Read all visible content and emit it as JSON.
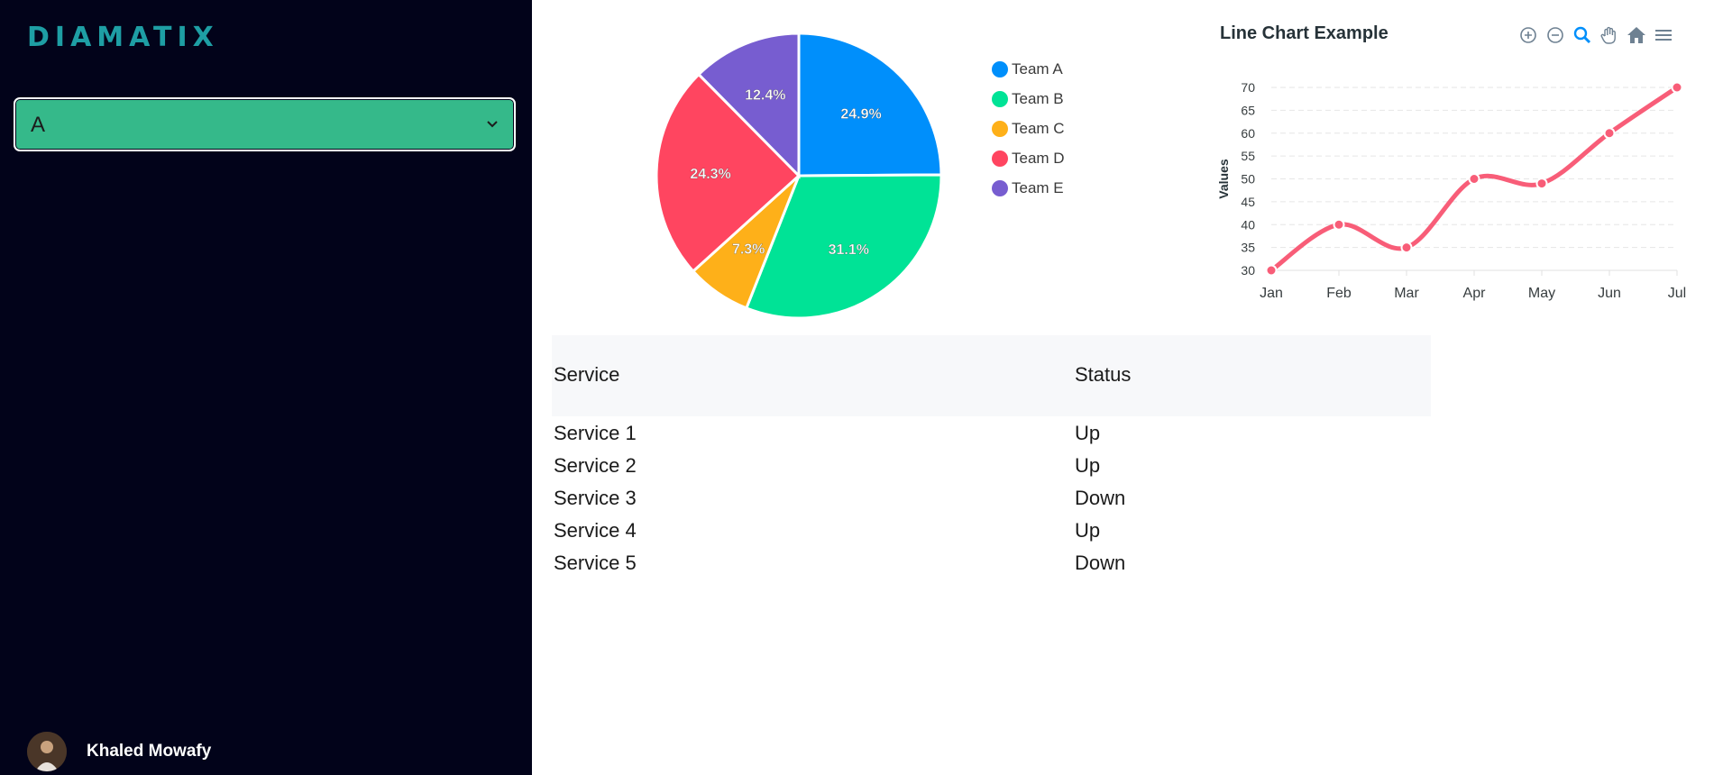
{
  "sidebar": {
    "logo": "DIAMATIX",
    "select": {
      "value": "A",
      "options": [
        "A"
      ]
    },
    "user": {
      "name": "Khaled Mowafy"
    }
  },
  "pie_chart": {
    "type": "pie",
    "slices": [
      {
        "label": "Team A",
        "percent": 24.9,
        "value_label": "24.9%",
        "color": "#008ffb"
      },
      {
        "label": "Team B",
        "percent": 31.1,
        "value_label": "31.1%",
        "color": "#00e396"
      },
      {
        "label": "Team C",
        "percent": 7.3,
        "value_label": "7.3%",
        "color": "#feb019"
      },
      {
        "label": "Team D",
        "percent": 24.3,
        "value_label": "24.3%",
        "color": "#ff4560"
      },
      {
        "label": "Team E",
        "percent": 12.4,
        "value_label": "12.4%",
        "color": "#775dd0"
      }
    ],
    "legend_position": "right"
  },
  "chart_data": [
    {
      "type": "pie",
      "categories": [
        "Team A",
        "Team B",
        "Team C",
        "Team D",
        "Team E"
      ],
      "values": [
        24.9,
        31.1,
        7.3,
        24.3,
        12.4
      ],
      "title": "",
      "legend": "right"
    },
    {
      "type": "line",
      "title": "Line Chart Example",
      "categories": [
        "Jan",
        "Feb",
        "Mar",
        "Apr",
        "May",
        "Jun",
        "Jul"
      ],
      "series": [
        {
          "values": [
            30,
            40,
            35,
            50,
            49,
            60,
            70
          ],
          "color": "#f85d78"
        }
      ],
      "xlabel": "",
      "ylabel": "Values",
      "ylim": [
        30,
        70
      ],
      "yticks": [
        30,
        35,
        40,
        45,
        50,
        55,
        60,
        65,
        70
      ],
      "grid": "horizontal dashed",
      "curve": "smooth"
    }
  ],
  "line_chart": {
    "title": "Line Chart Example",
    "ylabel": "Values",
    "toolbar": [
      "zoom-in-icon",
      "zoom-out-icon",
      "selection-zoom-icon",
      "pan-icon",
      "home-icon",
      "menu-icon"
    ]
  },
  "table": {
    "headers": {
      "service": "Service",
      "status": "Status"
    },
    "rows": [
      {
        "service": "Service 1",
        "status": "Up"
      },
      {
        "service": "Service 2",
        "status": "Up"
      },
      {
        "service": "Service 3",
        "status": "Down"
      },
      {
        "service": "Service 4",
        "status": "Up"
      },
      {
        "service": "Service 5",
        "status": "Down"
      }
    ]
  }
}
